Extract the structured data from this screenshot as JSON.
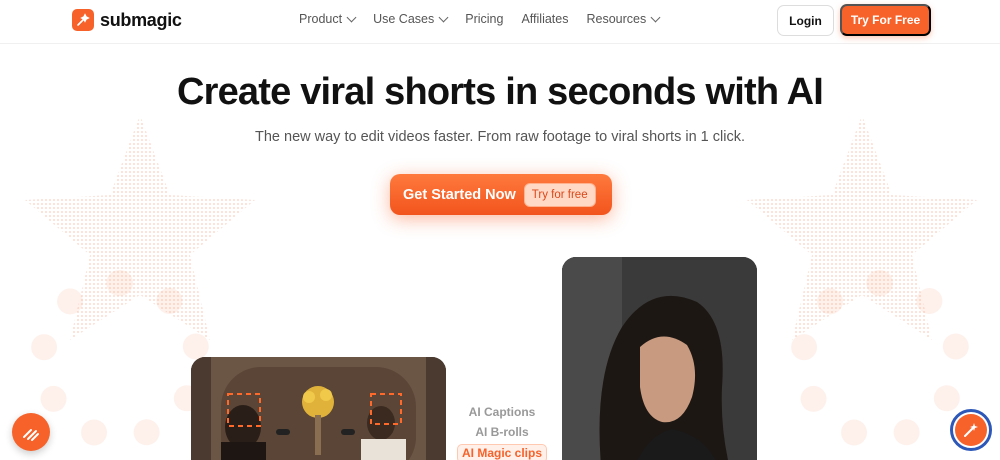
{
  "brand": {
    "name": "submagic",
    "accent": "#f6622a"
  },
  "nav": {
    "items": [
      {
        "label": "Product",
        "has_dropdown": true
      },
      {
        "label": "Use Cases",
        "has_dropdown": true
      },
      {
        "label": "Pricing",
        "has_dropdown": false
      },
      {
        "label": "Affiliates",
        "has_dropdown": false
      },
      {
        "label": "Resources",
        "has_dropdown": true
      }
    ],
    "login_label": "Login",
    "try_label": "Try For Free"
  },
  "hero": {
    "title": "Create viral shorts in seconds with AI",
    "subtitle": "The new way to edit videos faster. From raw footage to viral shorts in 1 click.",
    "cta_label": "Get Started Now",
    "cta_pill": "Try for free"
  },
  "features": {
    "items": [
      "AI Captions",
      "AI B-rolls",
      "AI Magic clips"
    ],
    "active_index": 2
  },
  "icons": {
    "logo": "submagic-logo-icon",
    "fab_left": "magic-lines-icon",
    "fab_right": "magic-wand-icon"
  }
}
